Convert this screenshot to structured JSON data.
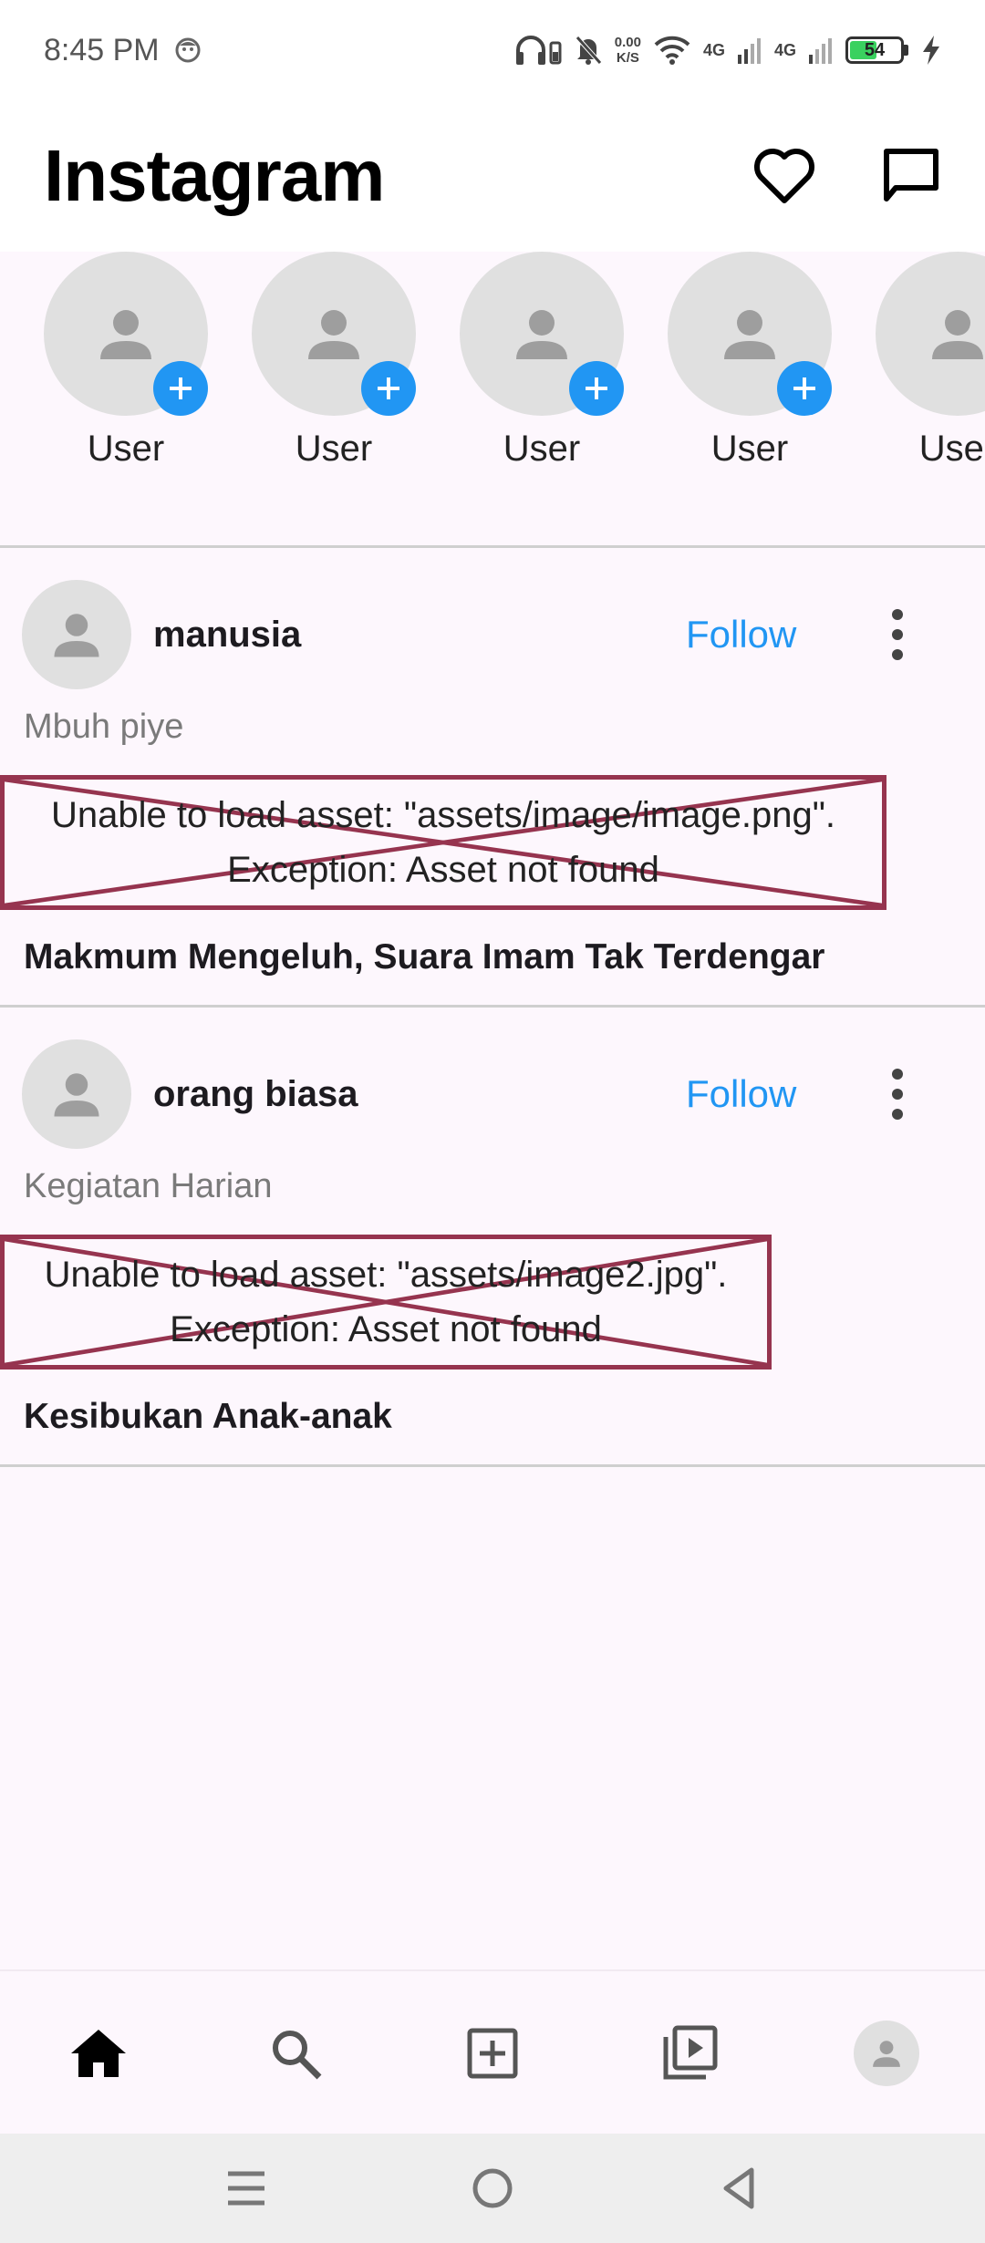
{
  "status_bar": {
    "time": "8:45 PM",
    "net_speed_value": "0.00",
    "net_speed_unit": "K/S",
    "network_1": "4G",
    "network_2": "4G",
    "battery": "54"
  },
  "app_bar": {
    "title": "Instagram",
    "icons": [
      "heart-icon",
      "message-icon"
    ]
  },
  "stories": [
    {
      "label": "User"
    },
    {
      "label": "User"
    },
    {
      "label": "User"
    },
    {
      "label": "User"
    },
    {
      "label": "User"
    }
  ],
  "posts": [
    {
      "username": "manusia",
      "follow_label": "Follow",
      "caption": "Mbuh piye",
      "error_line1": "Unable to load asset: \"assets/image/image.png\".",
      "error_line2": "Exception: Asset not found",
      "title": "Makmum Mengeluh, Suara Imam Tak Terdengar"
    },
    {
      "username": "orang biasa",
      "follow_label": "Follow",
      "caption": "Kegiatan Harian",
      "error_line1": "Unable to load asset: \"assets/image2.jpg\".",
      "error_line2": "Exception: Asset not found",
      "title": "Kesibukan Anak-anak"
    }
  ],
  "bottom_nav": [
    "home-icon",
    "search-icon",
    "add-post-icon",
    "reels-icon",
    "profile-avatar"
  ],
  "colors": {
    "accent": "#2196f3",
    "error_border": "#96344f",
    "background": "#fdf7fd"
  }
}
